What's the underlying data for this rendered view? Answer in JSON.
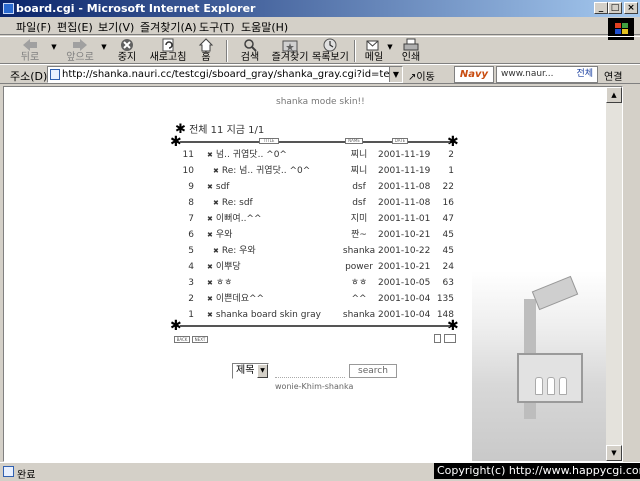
{
  "window": {
    "title": "board.cgi - Microsoft Internet Explorer"
  },
  "menu": [
    "파일(F)",
    "편집(E)",
    "보기(V)",
    "즐겨찾기(A)",
    "도구(T)",
    "도움말(H)"
  ],
  "toolbar": {
    "back": "뒤로",
    "forward": "앞으로",
    "stop": "중지",
    "refresh": "새로고침",
    "home": "홈",
    "search": "검색",
    "favorites": "즐겨찾기",
    "history": "목록보기",
    "mail": "메일",
    "print": "인쇄"
  },
  "address": {
    "label": "주소(D)",
    "url": "http://shanka.nauri.cc/testcgi/sboard_gray/shanka_gray.cgi?id=test",
    "go": "이동",
    "navy_logo": "Navy",
    "navy_search": "www.naur...",
    "navy_all": "전체",
    "links": "연결"
  },
  "board": {
    "skin_title": "shanka mode skin!!",
    "counter": "전체 11 지금 1/1",
    "header_tags": [
      "TITLE",
      "NAME",
      "DATE"
    ],
    "rows": [
      {
        "num": "11",
        "subject": "넘.. 귀엽닷.. ^0^",
        "name": "찌니",
        "date": "2001-11-19",
        "hit": "2",
        "reply": false
      },
      {
        "num": "10",
        "subject": "Re: 넘.. 귀엽닷.. ^0^",
        "name": "찌니",
        "date": "2001-11-19",
        "hit": "1",
        "reply": true
      },
      {
        "num": "9",
        "subject": "sdf",
        "name": "dsf",
        "date": "2001-11-08",
        "hit": "22",
        "reply": false
      },
      {
        "num": "8",
        "subject": "Re: sdf",
        "name": "dsf",
        "date": "2001-11-08",
        "hit": "16",
        "reply": true
      },
      {
        "num": "7",
        "subject": "이뻐여..^^",
        "name": "지미",
        "date": "2001-11-01",
        "hit": "47",
        "reply": false
      },
      {
        "num": "6",
        "subject": "우와",
        "name": "짠~",
        "date": "2001-10-21",
        "hit": "45",
        "reply": false
      },
      {
        "num": "5",
        "subject": "Re: 우와",
        "name": "shanka",
        "date": "2001-10-22",
        "hit": "45",
        "reply": true
      },
      {
        "num": "4",
        "subject": "이뿌당",
        "name": "power",
        "date": "2001-10-21",
        "hit": "24",
        "reply": false
      },
      {
        "num": "3",
        "subject": "ㅎㅎ",
        "name": "ㅎㅎ",
        "date": "2001-10-05",
        "hit": "63",
        "reply": false
      },
      {
        "num": "2",
        "subject": "이쁜데요^^",
        "name": "^^",
        "date": "2001-10-04",
        "hit": "135",
        "reply": false
      },
      {
        "num": "1",
        "subject": "shanka board skin gray",
        "name": "shanka",
        "date": "2001-10-04",
        "hit": "148",
        "reply": false
      }
    ],
    "back_btn": "BACK",
    "next_btn": "NEXT",
    "search_select": "제목",
    "search_btn": "search",
    "credit": "wonie-Khim-shanka"
  },
  "status": {
    "text": "완료",
    "copyright": "Copyright(c) http://www.happycgi.com"
  }
}
